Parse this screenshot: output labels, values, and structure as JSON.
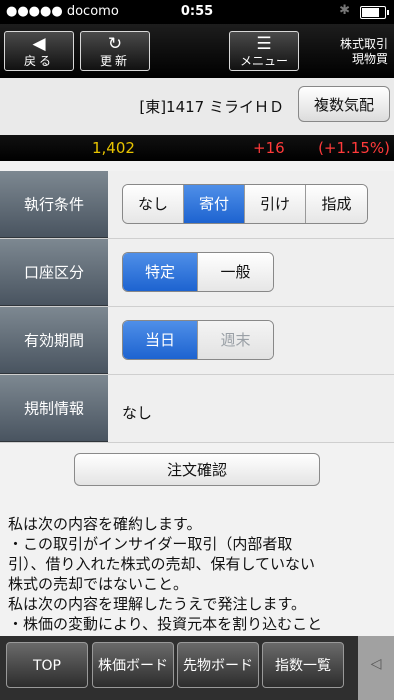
{
  "status_bar": {
    "carrier": "●●●●● docomo",
    "time": "0:55"
  },
  "toolbar": {
    "back_label": "戻る",
    "refresh_label": "更新",
    "menu_label": "メニュー",
    "title_line1": "株式取引",
    "title_line2": "現物買"
  },
  "stock": {
    "name": "[東]1417 ミライＨＤ",
    "quote_button": "複数気配"
  },
  "price": {
    "last": "1,402",
    "change": "+16",
    "change_pct": "(+1.15%)"
  },
  "form": {
    "exec_condition": {
      "label": "執行条件",
      "options": [
        "なし",
        "寄付",
        "引け",
        "指成"
      ],
      "selected": "寄付"
    },
    "account_type": {
      "label": "口座区分",
      "options": [
        "特定",
        "一般"
      ],
      "selected": "特定"
    },
    "validity": {
      "label": "有効期間",
      "options": [
        "当日",
        "週末"
      ],
      "selected": "当日"
    },
    "regulation": {
      "label": "規制情報",
      "value": "なし"
    }
  },
  "confirm_button": "注文確認",
  "notice": [
    "私は次の内容を確約します。",
    "・この取引がインサイダー取引（内部者取",
    "引）、借り入れた株式の売却、保有していない",
    "株式の売却ではないこと。",
    "私は次の内容を理解したうえで発注します。",
    "・株価の変動により、投資元本を割り込むこと"
  ],
  "bottom_nav": [
    "TOP",
    "株価ボード",
    "先物ボード",
    "指数一覧"
  ]
}
